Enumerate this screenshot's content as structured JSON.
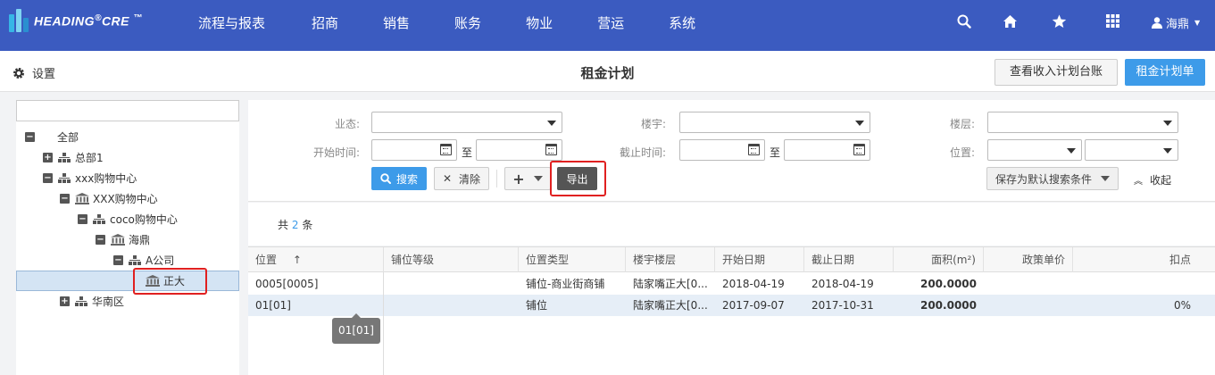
{
  "app": {
    "logo_text": "HEADING",
    "logo_reg": "®",
    "logo_suffix": "CRE",
    "logo_tm": "™"
  },
  "nav": {
    "items": [
      "流程与报表",
      "招商",
      "销售",
      "账务",
      "物业",
      "营运",
      "系统"
    ],
    "icons": [
      "search-icon",
      "home-icon",
      "star-icon",
      "grid-icon"
    ],
    "user_name": "海鼎"
  },
  "subheader": {
    "settings_label": "设置",
    "title": "租金计划",
    "ledger_button": "查看收入计划台账",
    "plan_button": "租金计划单"
  },
  "tree": {
    "search_placeholder": "",
    "nodes": [
      {
        "label": "全部",
        "toggle": "−",
        "icon": "none"
      },
      {
        "label": "总部1",
        "toggle": "+",
        "icon": "org-icon"
      },
      {
        "label": "xxx购物中心",
        "toggle": "−",
        "icon": "org-icon"
      },
      {
        "label": "XXX购物中心",
        "toggle": "−",
        "icon": "bank-icon"
      },
      {
        "label": "coco购物中心",
        "toggle": "−",
        "icon": "org-icon"
      },
      {
        "label": "海鼎",
        "toggle": "−",
        "icon": "bank-icon"
      },
      {
        "label": "A公司",
        "toggle": "−",
        "icon": "org-icon"
      },
      {
        "label": "正大",
        "toggle": "",
        "icon": "bank-icon"
      },
      {
        "label": "华南区",
        "toggle": "+",
        "icon": "org-icon"
      }
    ],
    "selected": "正大"
  },
  "search": {
    "labels": {
      "business": "业态:",
      "building": "楼宇:",
      "floor": "楼层:",
      "start_time": "开始时间:",
      "end_time": "截止时间:",
      "position": "位置:",
      "to": "至"
    },
    "values": {
      "business": "",
      "building": "",
      "floor": "",
      "start_from": "",
      "start_to": "",
      "end_from": "",
      "end_to": "",
      "position_a": "",
      "position_b": ""
    },
    "buttons": {
      "search": "搜索",
      "clear": "清除",
      "add": "+",
      "export": "导出",
      "save_default": "保存为默认搜索条件",
      "collapse": "收起"
    }
  },
  "result": {
    "count_prefix": "共",
    "count": "2",
    "count_suffix": "条"
  },
  "table": {
    "columns": [
      "位置",
      "铺位等级",
      "位置类型",
      "楼宇楼层",
      "开始日期",
      "截止日期",
      "面积(m²)",
      "政策单价",
      "扣点"
    ],
    "sort_indicator": "↑",
    "rows": [
      {
        "position": "0005[0005]",
        "grade": "",
        "type": "铺位-商业街商铺",
        "floor": "陆家嘴正大[0...",
        "start": "2018-04-19",
        "end": "2018-04-19",
        "area": "200.0000",
        "price": "",
        "deduct": ""
      },
      {
        "position": "01[01]",
        "grade": "",
        "type": "铺位",
        "floor": "陆家嘴正大[0...",
        "start": "2017-09-07",
        "end": "2017-10-31",
        "area": "200.0000",
        "price": "",
        "deduct": "0%"
      }
    ],
    "tooltip": "01[01]"
  },
  "colors": {
    "nav_bg": "#3b5bc0",
    "primary": "#3d9be9",
    "export_bg": "#555555",
    "highlight_border": "#e02020",
    "selected_row": "#dce8f5"
  }
}
